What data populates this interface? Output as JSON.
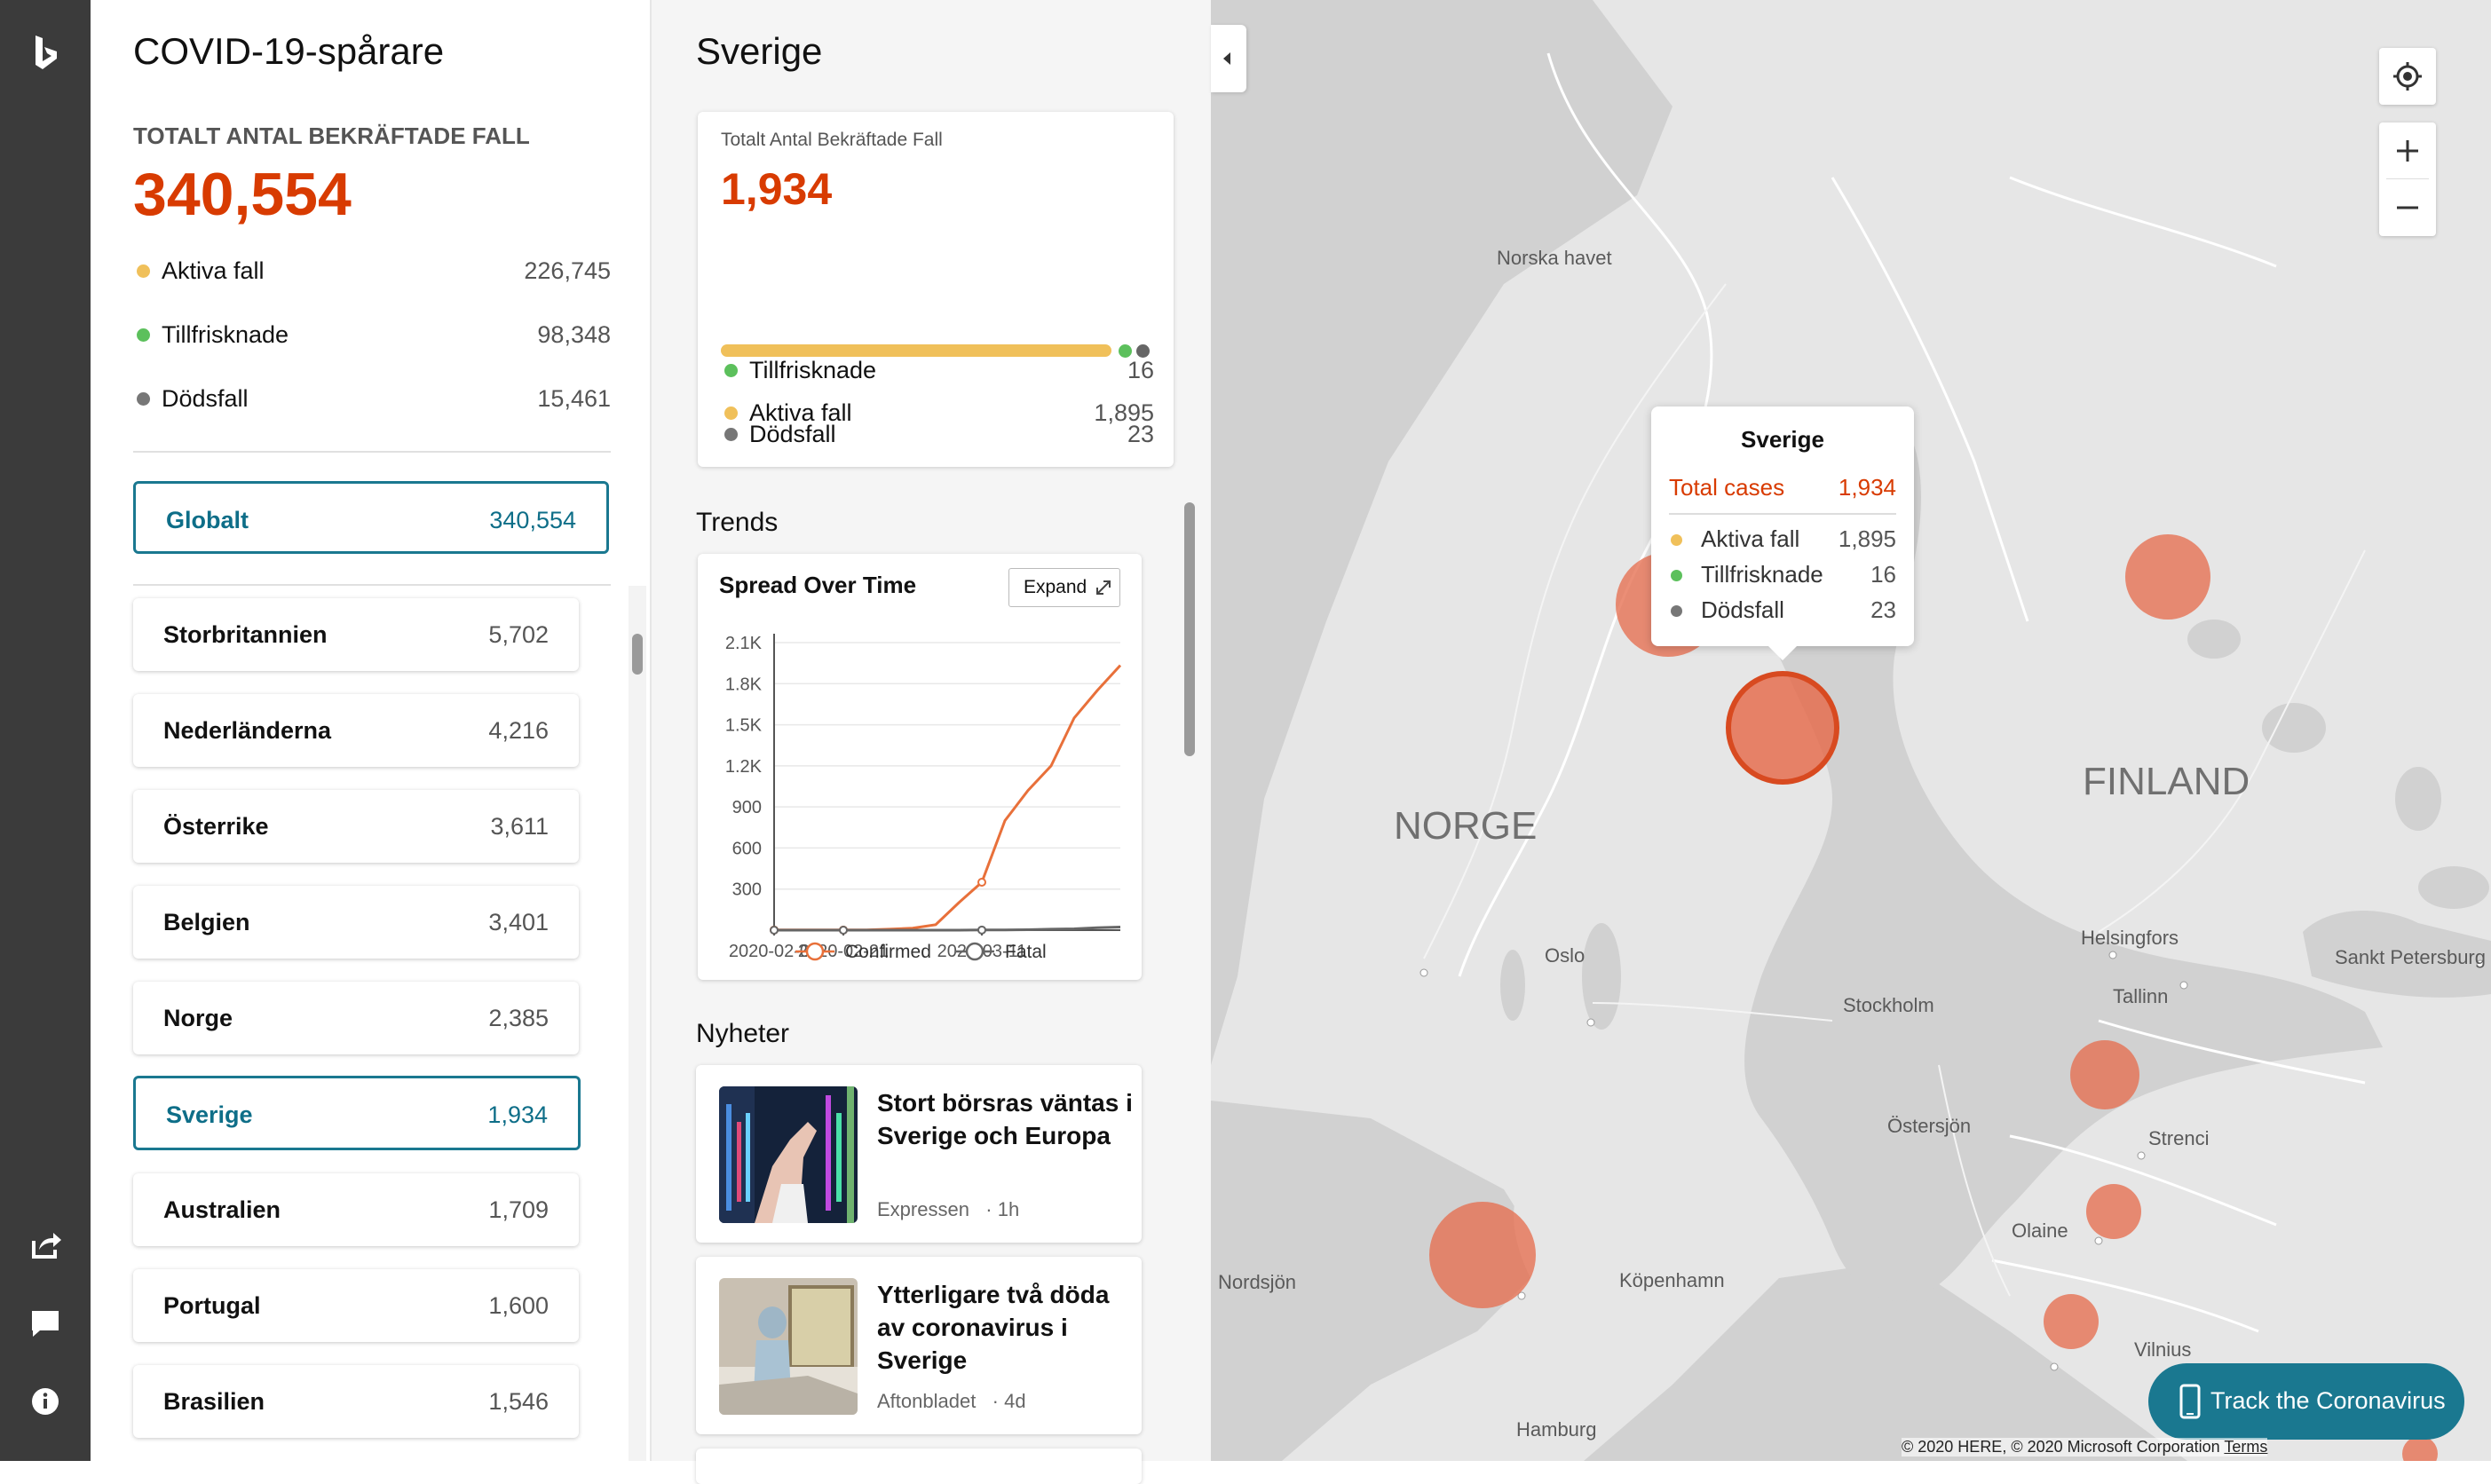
{
  "rail": {
    "logo": "bing-logo-icon",
    "share_icon": "share-icon",
    "feedback_icon": "feedback-icon",
    "info_icon": "info-icon"
  },
  "tracker": {
    "title": "COVID-19-spårare",
    "total_label": "TOTALT ANTAL BEKRÄFTADE FALL",
    "total_value": "340,554",
    "stats": [
      {
        "label": "Aktiva fall",
        "value": "226,745",
        "color": "#f0c05a"
      },
      {
        "label": "Tillfrisknade",
        "value": "98,348",
        "color": "#5cc05c"
      },
      {
        "label": "Dödsfall",
        "value": "15,461",
        "color": "#777777"
      }
    ],
    "global": {
      "name": "Globalt",
      "value": "340,554"
    },
    "countries": [
      {
        "name": "Storbritannien",
        "value": "5,702"
      },
      {
        "name": "Nederländerna",
        "value": "4,216"
      },
      {
        "name": "Österrike",
        "value": "3,611"
      },
      {
        "name": "Belgien",
        "value": "3,401"
      },
      {
        "name": "Norge",
        "value": "2,385"
      },
      {
        "name": "Sverige",
        "value": "1,934",
        "selected": true
      },
      {
        "name": "Australien",
        "value": "1,709"
      },
      {
        "name": "Portugal",
        "value": "1,600"
      },
      {
        "name": "Brasilien",
        "value": "1,546"
      }
    ]
  },
  "detail": {
    "country": "Sverige",
    "summary_label": "Totalt Antal Bekräftade Fall",
    "summary_value": "1,934",
    "stats": [
      {
        "label": "Aktiva fall",
        "value": "1,895",
        "color": "#f0c05a"
      },
      {
        "label": "Tillfrisknade",
        "value": "16",
        "color": "#5cc05c"
      },
      {
        "label": "Dödsfall",
        "value": "23",
        "color": "#777777"
      }
    ],
    "active_fraction": 0.98,
    "trends_heading": "Trends",
    "chart_title": "Spread Over Time",
    "expand_label": "Expand",
    "news_heading": "Nyheter",
    "news": [
      {
        "title": "Stort börsras väntas i Sverige och Europa",
        "source": "Expressen",
        "age": "· 1h"
      },
      {
        "title": "Ytterligare två döda av coronavirus i Sverige",
        "source": "Aftonbladet",
        "age": "· 4d"
      }
    ]
  },
  "chart_data": {
    "type": "line",
    "title": "Spread Over Time",
    "x": [
      "2020-02-02",
      "2020-02-09",
      "2020-02-16",
      "2020-02-21",
      "2020-02-25",
      "2020-02-28",
      "2020-03-02",
      "2020-03-05",
      "2020-03-08",
      "2020-03-11",
      "2020-03-13",
      "2020-03-15",
      "2020-03-17",
      "2020-03-19",
      "2020-03-21",
      "2020-03-23"
    ],
    "x_ticks": [
      "2020-02-02",
      "2020-02-21",
      "2020-03-11"
    ],
    "y_ticks": [
      "2.1K",
      "1.8K",
      "1.5K",
      "1.2K",
      "900",
      "600",
      "300"
    ],
    "ylim": [
      0,
      2100
    ],
    "series": [
      {
        "name": "Confirmed",
        "color": "#e8703a",
        "values": [
          1,
          1,
          1,
          1,
          1,
          7,
          15,
          40,
          200,
          350,
          800,
          1020,
          1200,
          1550,
          1750,
          1934
        ]
      },
      {
        "name": "Fatal",
        "color": "#666666",
        "values": [
          0,
          0,
          0,
          0,
          0,
          0,
          0,
          0,
          0,
          1,
          1,
          3,
          7,
          10,
          18,
          23
        ]
      }
    ],
    "legend": "bottom"
  },
  "map": {
    "labels": [
      {
        "text": "Norska havet"
      },
      {
        "text": "Oslo"
      },
      {
        "text": "Stockholm"
      },
      {
        "text": "Helsingfors"
      },
      {
        "text": "Sankt Petersburg"
      },
      {
        "text": "Tallinn"
      },
      {
        "text": "Östersjön"
      },
      {
        "text": "Strenci"
      },
      {
        "text": "Olaine"
      },
      {
        "text": "Nordsjön"
      },
      {
        "text": "Köpenhamn"
      },
      {
        "text": "Vilnius"
      },
      {
        "text": "Hamburg"
      }
    ],
    "big_labels": [
      "NORGE",
      "FINLAND"
    ],
    "tooltip": {
      "title": "Sverige",
      "total_label": "Total cases",
      "total_value": "1,934",
      "rows": [
        {
          "label": "Aktiva fall",
          "value": "1,895",
          "color": "#f0c05a"
        },
        {
          "label": "Tillfrisknade",
          "value": "16",
          "color": "#5cc05c"
        },
        {
          "label": "Dödsfall",
          "value": "23",
          "color": "#777777"
        }
      ]
    },
    "controls": {
      "locate_icon": "locate-icon",
      "zoom_in_icon": "plus-icon",
      "zoom_out_icon": "minus-icon"
    },
    "cta": "Track the Coronavirus",
    "copyright": "© 2020 HERE, © 2020 Microsoft Corporation",
    "terms": "Terms"
  }
}
